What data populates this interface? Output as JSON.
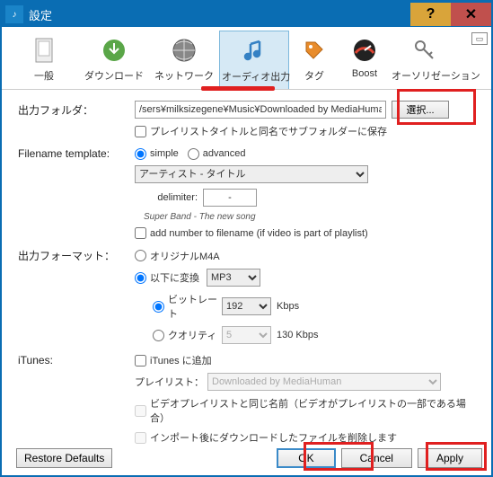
{
  "window": {
    "title": "設定"
  },
  "toolbar": {
    "items": [
      {
        "label": "一般"
      },
      {
        "label": "ダウンロード"
      },
      {
        "label": "ネットワーク"
      },
      {
        "label": "オーディオ出力"
      },
      {
        "label": "タグ"
      },
      {
        "label": "Boost"
      },
      {
        "label": "オーソリゼーション"
      }
    ]
  },
  "labels": {
    "output_folder": "出力フォルダ：",
    "filename_template": "Filename template:",
    "output_format": "出力フォーマット：",
    "itunes": "iTunes:",
    "delimiter": "delimiter:",
    "playlist": "プレイリスト："
  },
  "values": {
    "output_folder": "/sers¥milksizegene¥Music¥Downloaded by MediaHuman",
    "select_btn": "選択...",
    "save_subfolder": "プレイリストタイトルと同名でサブフォルダーに保存",
    "tpl_simple": "simple",
    "tpl_advanced": "advanced",
    "artist_title": "アーティスト - タイトル",
    "delimiter": "-",
    "hint": "Super Band - The new song",
    "add_number": "add number to filename (if video is part of playlist)",
    "original_m4a": "オリジナルM4A",
    "convert_to": "以下に変換",
    "format": "MP3",
    "bitrate_label": "ビットレート",
    "bitrate": "192",
    "kbps": "Kbps",
    "quality_label": "クオリティ",
    "quality": "5",
    "quality_kbps": "130 Kbps",
    "add_to_itunes": "iTunes に追加",
    "playlist_name": "Downloaded by MediaHuman",
    "video_playlist": "ビデオプレイリストと同じ名前（ビデオがプレイリストの一部である場合）",
    "delete_after": "インポート後にダウンロードしたファイルを削除します"
  },
  "footer": {
    "restore": "Restore Defaults",
    "ok": "OK",
    "cancel": "Cancel",
    "apply": "Apply"
  },
  "colors": {
    "accent": "#0a6db3",
    "highlight": "#e02020"
  }
}
